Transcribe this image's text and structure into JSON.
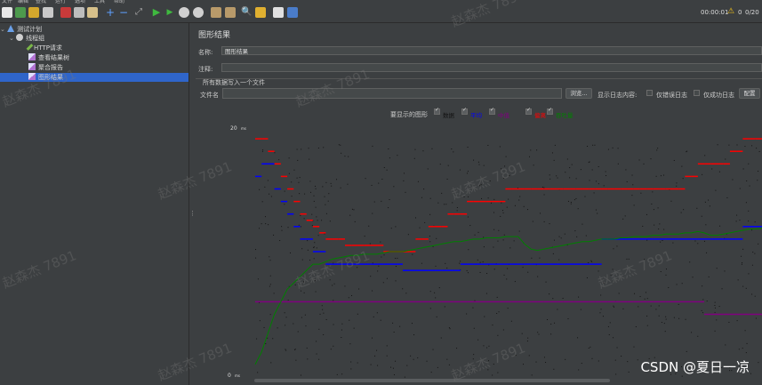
{
  "menubar": {
    "items": [
      "文件",
      "编辑",
      "查找",
      "运行",
      "选项",
      "工具",
      "帮助"
    ]
  },
  "toolbar": {
    "elapsed": "00:00:01",
    "warnings": "0",
    "threads": "0/20"
  },
  "tree": {
    "items": [
      {
        "label": "测试计划",
        "icon": "test-plan-icon"
      },
      {
        "label": "线程组",
        "icon": "thread-group-icon"
      },
      {
        "label": "HTTP请求",
        "icon": "http-sampler-icon"
      },
      {
        "label": "查看结果树",
        "icon": "listener-icon"
      },
      {
        "label": "聚合报告",
        "icon": "listener-icon"
      },
      {
        "label": "图形结果",
        "icon": "listener-icon"
      }
    ]
  },
  "panel": {
    "title": "图形结果",
    "name_label": "名称:",
    "name_value": "图形结果",
    "comment_label": "注释:",
    "comment_value": "",
    "section_label": "所有数据写入一个文件",
    "filename_label": "文件名",
    "filename_value": "",
    "browse_button": "浏览...",
    "log_display_label": "显示日志内容:",
    "errors_only_label": "仅错误日志",
    "success_only_label": "仅成功日志",
    "configure_button": "配置",
    "graphs_to_display_label": "要显示的图形",
    "legend": [
      {
        "label": "数据",
        "color": "#000000",
        "checked": true
      },
      {
        "label": "平均",
        "color": "#0000ff",
        "checked": true
      },
      {
        "label": "中值",
        "color": "#800080",
        "checked": true
      },
      {
        "label": "偏离",
        "color": "#ff0000",
        "checked": true
      },
      {
        "label": "吞吐量",
        "color": "#008000",
        "checked": true
      }
    ]
  },
  "chart_data": {
    "type": "line",
    "y_top_label": "20",
    "y_top_unit": "ms",
    "y_bottom_label": "0",
    "y_bottom_unit": "ms",
    "ylim": [
      0,
      20
    ],
    "x": [
      0,
      1,
      2,
      3,
      4,
      5,
      6,
      7,
      8,
      9,
      10,
      11,
      12,
      13,
      14,
      15,
      16,
      17,
      18,
      19,
      20,
      21,
      22,
      23,
      24,
      25,
      26,
      27,
      28,
      29,
      30,
      31,
      32,
      33,
      34,
      35,
      36,
      37,
      38,
      39,
      40,
      41,
      42,
      43,
      44,
      45,
      46,
      47,
      48,
      49,
      50,
      51,
      52,
      53,
      54,
      55,
      56,
      57,
      58,
      59,
      60,
      61,
      62,
      63,
      64,
      65,
      66,
      67,
      68,
      69,
      70,
      71,
      72,
      73,
      74,
      75,
      76,
      77,
      78,
      79
    ],
    "series": [
      {
        "name": "平均",
        "color": "#0000ff",
        "values": [
          16,
          17,
          17,
          15,
          14,
          13,
          12,
          11,
          11,
          10,
          10,
          9,
          9,
          9,
          9,
          9,
          9,
          9,
          9,
          9,
          9,
          9,
          9,
          8.5,
          8.5,
          8.5,
          8.5,
          8.5,
          8.5,
          8.5,
          8.5,
          8.5,
          9,
          9,
          9,
          9,
          9,
          9,
          9,
          9,
          9,
          9,
          9,
          9,
          9,
          9,
          9,
          9,
          9,
          9,
          9,
          9,
          9,
          9,
          11,
          11,
          11,
          11,
          11,
          11,
          11,
          11,
          11,
          11,
          11,
          11,
          11,
          11,
          11,
          11,
          11,
          11,
          11,
          11,
          11,
          11,
          12,
          12,
          12,
          12
        ]
      },
      {
        "name": "中值",
        "color": "#800080",
        "values": [
          6,
          6,
          6,
          6,
          6,
          6,
          6,
          6,
          6,
          6,
          6,
          6,
          6,
          6,
          6,
          6,
          6,
          6,
          6,
          6,
          6,
          6,
          6,
          6,
          6,
          6,
          6,
          6,
          6,
          6,
          6,
          6,
          6,
          6,
          6,
          6,
          6,
          6,
          6,
          6,
          6,
          6,
          6,
          6,
          6,
          6,
          6,
          6,
          6,
          6,
          6,
          6,
          6,
          6,
          6,
          6,
          6,
          6,
          6,
          6,
          6,
          6,
          6,
          6,
          6,
          6,
          6,
          6,
          6,
          6,
          5,
          5,
          5,
          5,
          5,
          5,
          5,
          5,
          5,
          5
        ]
      },
      {
        "name": "偏离",
        "color": "#ff0000",
        "values": [
          19,
          19,
          18,
          17,
          16,
          15,
          14,
          13,
          12.5,
          12,
          11.5,
          11,
          11,
          11,
          10.5,
          10.5,
          10.5,
          10.5,
          10.5,
          10.5,
          10,
          10,
          10,
          10,
          10,
          11,
          11,
          12,
          12,
          12,
          13,
          13,
          13,
          14,
          14,
          14,
          14,
          14,
          14,
          15,
          15,
          15,
          15,
          15,
          15,
          15,
          15,
          15,
          15,
          15,
          15,
          15,
          15,
          15,
          15,
          15,
          15,
          15,
          15,
          15,
          15,
          15,
          15,
          15,
          15,
          15,
          15,
          16,
          16,
          17,
          17,
          17,
          17,
          17,
          18,
          18,
          19,
          19,
          19,
          19
        ]
      },
      {
        "name": "吞吐量",
        "color": "#008000",
        "values": [
          1,
          2,
          3.5,
          5,
          6,
          7,
          7.5,
          8,
          8.5,
          9,
          9,
          9.2,
          9.4,
          9.5,
          9.6,
          9.7,
          9.7,
          9.8,
          9.8,
          9.8,
          9.9,
          10,
          10,
          10,
          10.1,
          10.2,
          10.3,
          10.4,
          10.5,
          10.6,
          10.7,
          10.8,
          10.8,
          10.9,
          11,
          11,
          11.1,
          11.1,
          11.1,
          11.2,
          11.2,
          11.2,
          10.6,
          10.2,
          10.1,
          10.2,
          10.3,
          10.4,
          10.5,
          10.6,
          10.7,
          10.8,
          10.8,
          10.9,
          11,
          11,
          11,
          11.1,
          11.1,
          11.2,
          11.2,
          11.2,
          11.3,
          11.3,
          11.4,
          11.4,
          11.4,
          11.5,
          11.5,
          11.6,
          11.5,
          11.3,
          11.3,
          11.4,
          11.5,
          11.6,
          11.7,
          11.8,
          11.8,
          11.9
        ]
      }
    ]
  }
}
